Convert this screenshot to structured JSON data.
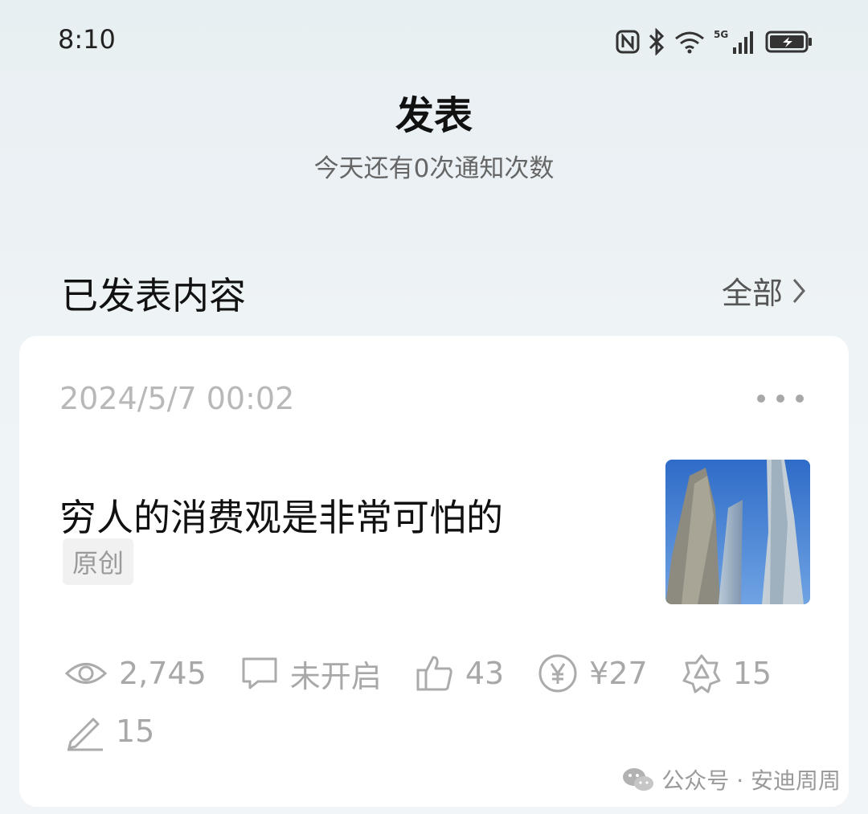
{
  "status_bar": {
    "time": "8:10",
    "icons": [
      "nfc-icon",
      "bluetooth-icon",
      "wifi-icon",
      "signal-5g-icon",
      "battery-charging-icon"
    ]
  },
  "header": {
    "title": "发表",
    "subtitle": "今天还有0次通知次数"
  },
  "published": {
    "section_title": "已发表内容",
    "all_label": "全部"
  },
  "article": {
    "timestamp": "2024/5/7 00:02",
    "title": "穷人的消费观是非常可怕的",
    "tag": "原创",
    "stats": {
      "views": "2,745",
      "comments": "未开启",
      "likes": "43",
      "rewards": "¥27",
      "shares": "15",
      "edits": "15"
    }
  },
  "watermark": {
    "text": "公众号 · 安迪周周"
  },
  "colors": {
    "background": "#eef3f5",
    "card": "#ffffff",
    "muted_text": "#a8a8a8",
    "sky": "#3f7ad1"
  }
}
